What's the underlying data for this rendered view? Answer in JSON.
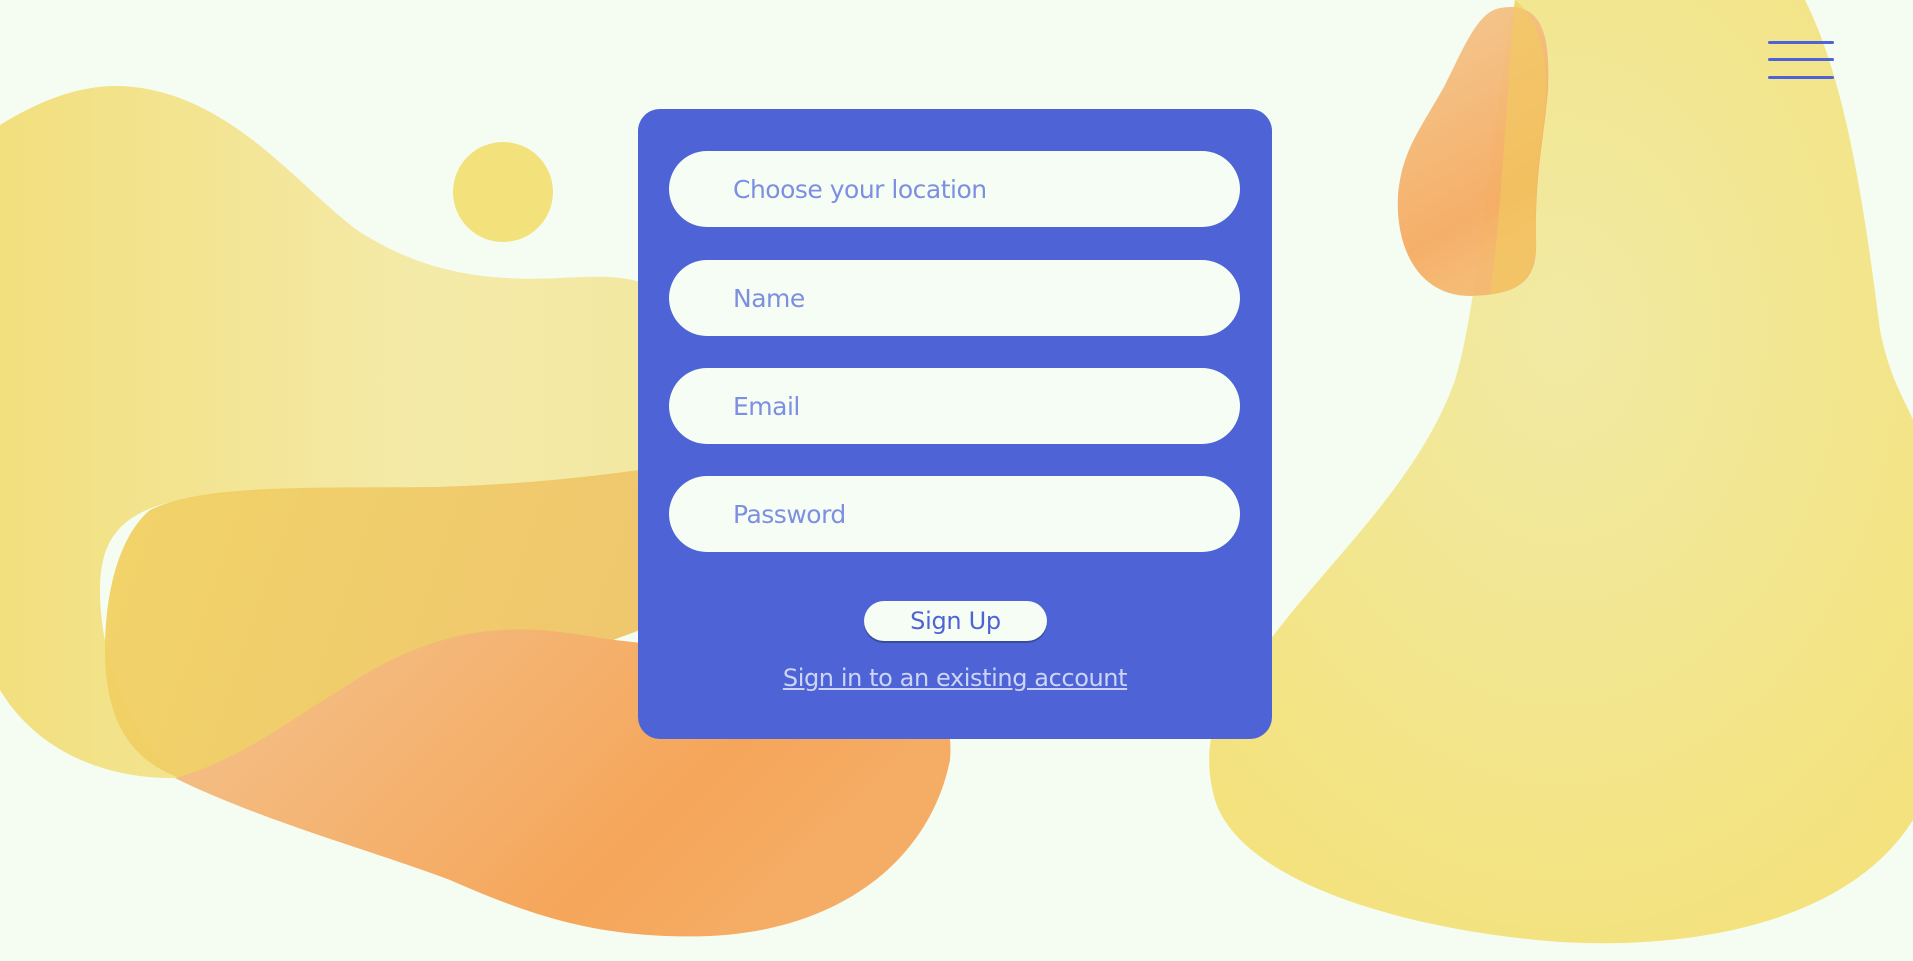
{
  "colors": {
    "background": "#f5fdf3",
    "card": "#4e63d6",
    "input_background": "#f6fdf4",
    "placeholder": "#7d8fe0",
    "link": "#cdd5f7",
    "blob_yellow": "#f3e27d",
    "blob_orange": "#f5a65a"
  },
  "menu": {
    "icon": "hamburger-menu-icon"
  },
  "form": {
    "location_placeholder": "Choose your location",
    "name_placeholder": "Name",
    "email_placeholder": "Email",
    "password_placeholder": "Password",
    "submit_label": "Sign Up",
    "signin_link_label": "Sign in to an existing account"
  }
}
